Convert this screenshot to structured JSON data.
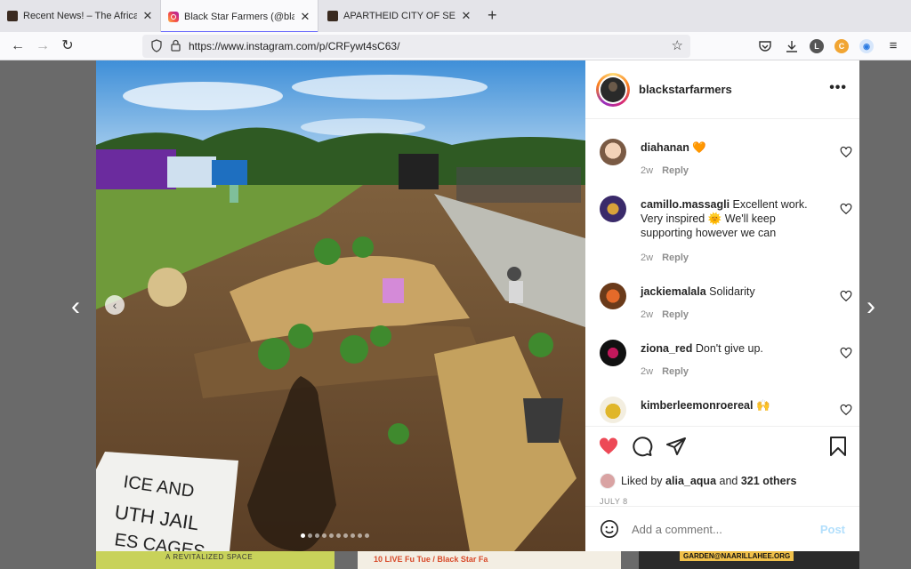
{
  "browser": {
    "tabs": [
      {
        "title": "Recent News! – The African Am",
        "favicon": "site-favicon",
        "active": false
      },
      {
        "title": "Black Star Farmers (@blackstarf",
        "favicon": "instagram-favicon",
        "active": true
      },
      {
        "title": "APARTHEID CITY OF SEATTLE D",
        "favicon": "site-favicon",
        "active": false
      }
    ],
    "new_tab_label": "+",
    "url": "https://www.instagram.com/p/CRFywt4sC63/",
    "toolbar_icons": [
      "pocket-icon",
      "download-icon",
      "account-l-icon",
      "extension-c-icon",
      "extension-icon",
      "menu-icon"
    ],
    "account_initial": "L",
    "ext_initial": "C"
  },
  "post": {
    "username": "blackstarfarmers",
    "more_label": "•••",
    "photo_description_alt": "Community garden with raised straw beds and a market",
    "carousel_total": 10,
    "carousel_index": 0,
    "comments": [
      {
        "user": "diahanan",
        "text": "🧡",
        "age": "2w",
        "reply": "Reply"
      },
      {
        "user": "camillo.massagli",
        "text": "Excellent work. Very inspired 🌞 We'll keep supporting however we can",
        "age": "2w",
        "reply": "Reply"
      },
      {
        "user": "jackiemalala",
        "text": "Solidarity",
        "age": "2w",
        "reply": "Reply"
      },
      {
        "user": "ziona_red",
        "text": "Don't give up.",
        "age": "2w",
        "reply": "Reply"
      },
      {
        "user": "kimberleemonroereal",
        "text": "🙌",
        "age": "",
        "reply": ""
      }
    ],
    "liked_by_prefix": "Liked by",
    "liked_by_user": "alia_aqua",
    "liked_by_and": "and",
    "liked_by_others": "321 others",
    "date": "JULY 8",
    "comment_placeholder": "Add a comment...",
    "post_label": "Post"
  },
  "background_page": {
    "left_caption": "A REVITALIZED SPACE",
    "middle_caption": "10 LIVE Fu Tue / Black Star Fa",
    "right_caption": "GARDEN@NAARILLAHEE.ORG"
  },
  "colors": {
    "like_red": "#ed4956",
    "post_disabled": "#b2dffc",
    "overlay": "#6a6a6a"
  }
}
